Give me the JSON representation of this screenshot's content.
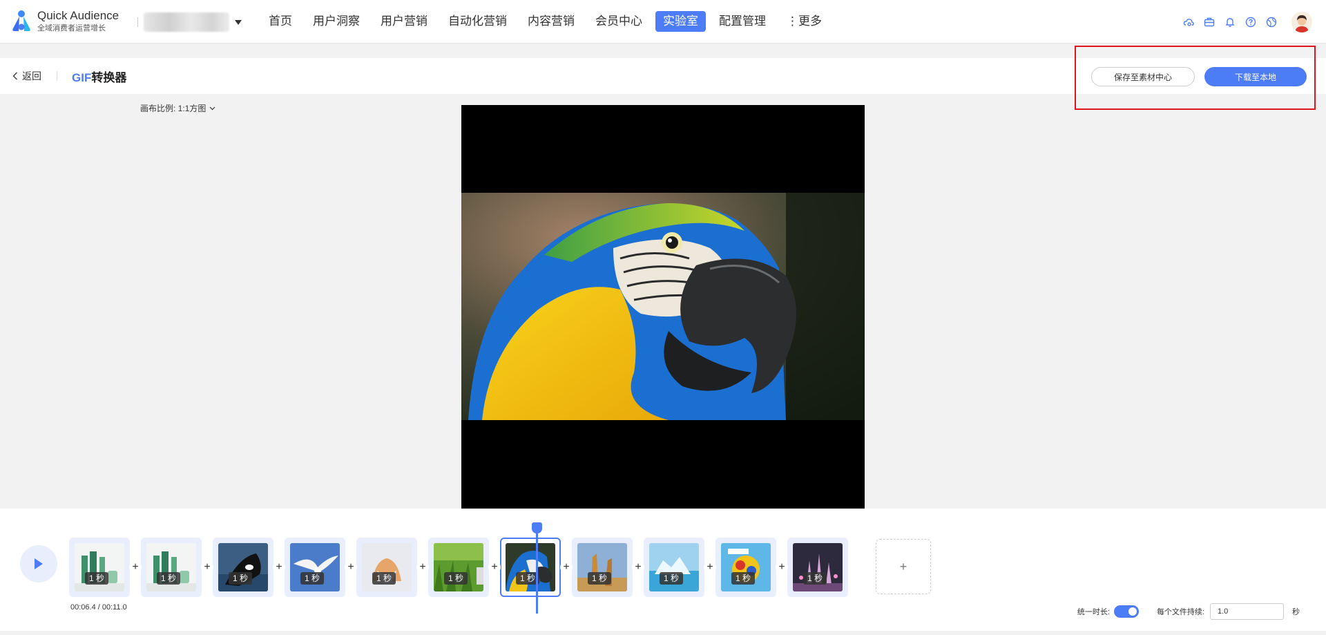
{
  "brand": {
    "name": "Quick Audience",
    "tagline": "全域消费者运营增长"
  },
  "nav": {
    "items": [
      {
        "label": "首页",
        "active": false
      },
      {
        "label": "用户洞察",
        "active": false
      },
      {
        "label": "用户营销",
        "active": false
      },
      {
        "label": "自动化营销",
        "active": false
      },
      {
        "label": "内容营销",
        "active": false
      },
      {
        "label": "会员中心",
        "active": false
      },
      {
        "label": "实验室",
        "active": true
      },
      {
        "label": "配置管理",
        "active": false
      },
      {
        "label": "⋮更多",
        "active": false
      }
    ],
    "icons": [
      "cloud-settings-icon",
      "toolbox-icon",
      "bell-icon",
      "help-icon",
      "globe-icon"
    ]
  },
  "subheader": {
    "back_label": "返回",
    "title_highlight": "GIF",
    "title_rest": "转换器",
    "save_button": "保存至素材中心",
    "download_button": "下载至本地"
  },
  "canvas": {
    "ratio_label": "画布比例: 1:1方图"
  },
  "timeline": {
    "frames": [
      {
        "duration": "1 秒",
        "scene": "cosmetics"
      },
      {
        "duration": "1 秒",
        "scene": "cosmetics"
      },
      {
        "duration": "1 秒",
        "scene": "orca"
      },
      {
        "duration": "1 秒",
        "scene": "seagull"
      },
      {
        "duration": "1 秒",
        "scene": "fox"
      },
      {
        "duration": "1 秒",
        "scene": "grass"
      },
      {
        "duration": "1 秒",
        "scene": "parrot"
      },
      {
        "duration": "1 秒",
        "scene": "giraffes"
      },
      {
        "duration": "1 秒",
        "scene": "iceberg"
      },
      {
        "duration": "1 秒",
        "scene": "cartoon"
      },
      {
        "duration": "1 秒",
        "scene": "castle"
      }
    ],
    "selected_index": 6,
    "add_label": "+",
    "timecode": "00:06.4 / 00:11.0",
    "uniform_label": "统一时长:",
    "uniform_on": true,
    "per_file_label": "每个文件持续:",
    "per_file_value": "1.0",
    "unit": "秒"
  },
  "colors": {
    "accent": "#4d7cf7",
    "highlight": "#e0141b"
  }
}
